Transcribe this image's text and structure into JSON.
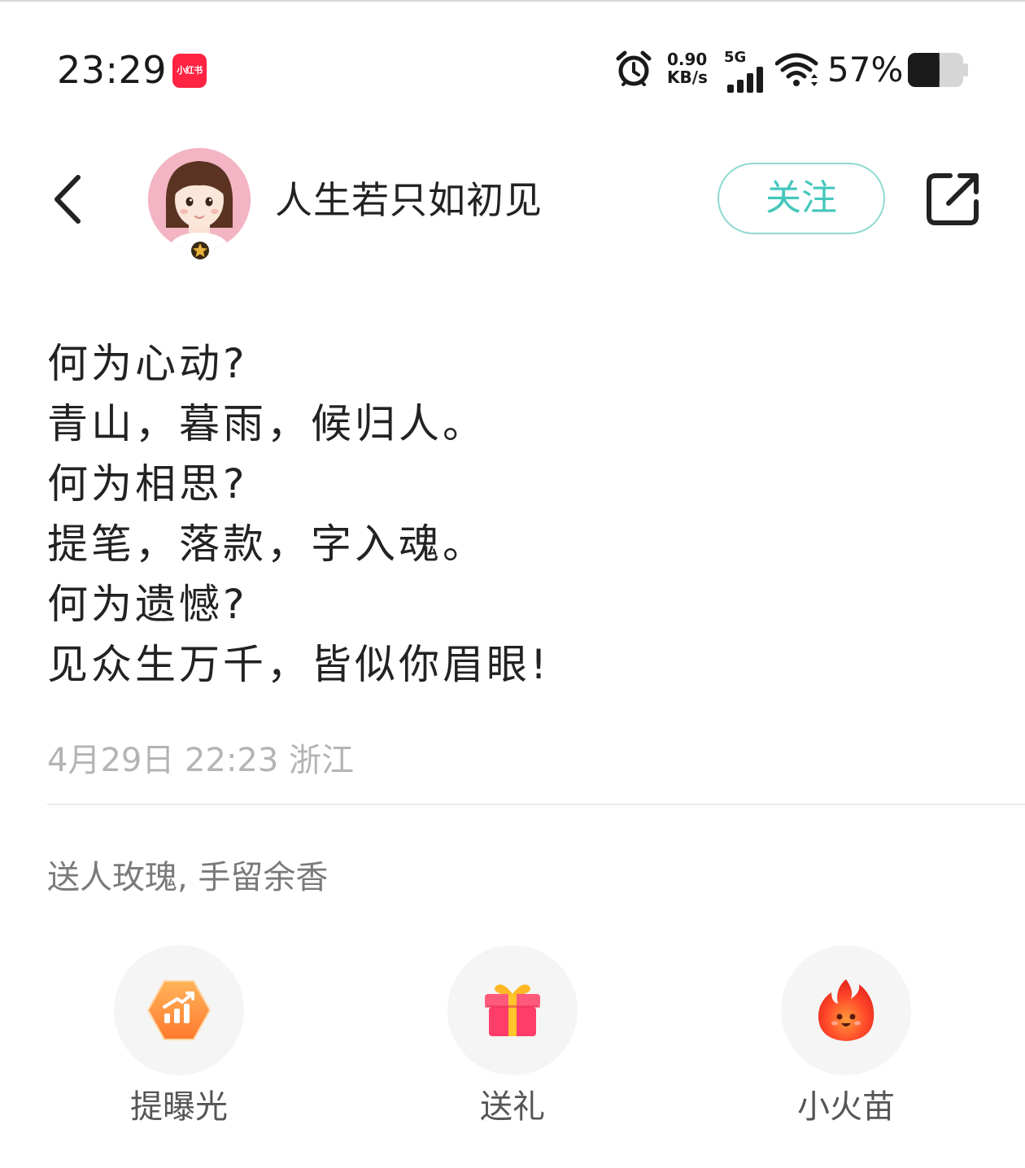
{
  "status_bar": {
    "time": "23:29",
    "app_badge": "小红书",
    "net_speed_value": "0.90",
    "net_speed_unit": "KB/s",
    "network_type": "5G",
    "battery_percent": "57%",
    "battery_level": 0.57,
    "icons": [
      "alarm-icon",
      "signal-icon",
      "wifi-icon",
      "battery-icon"
    ]
  },
  "header": {
    "back_icon": "chevron-left-icon",
    "username": "人生若只如初见",
    "follow_label": "关注",
    "share_icon": "share-external-icon"
  },
  "post": {
    "lines": [
      "何为心动?",
      "青山，暮雨，候归人。",
      "何为相思?",
      "提笔，落款，字入魂。",
      "何为遗憾?",
      "见众生万千，皆似你眉眼!"
    ],
    "meta": "4月29日 22:23 浙江"
  },
  "gift_section": {
    "prompt": "送人玫瑰, 手留余香",
    "actions": [
      {
        "label": "提曝光",
        "icon": "boost-exposure-icon"
      },
      {
        "label": "送礼",
        "icon": "gift-box-icon"
      },
      {
        "label": "小火苗",
        "icon": "flame-icon"
      }
    ]
  },
  "colors": {
    "follow_accent": "#45c7bc",
    "app_badge": "#ff2442",
    "meta_text": "#b4b4b4"
  }
}
